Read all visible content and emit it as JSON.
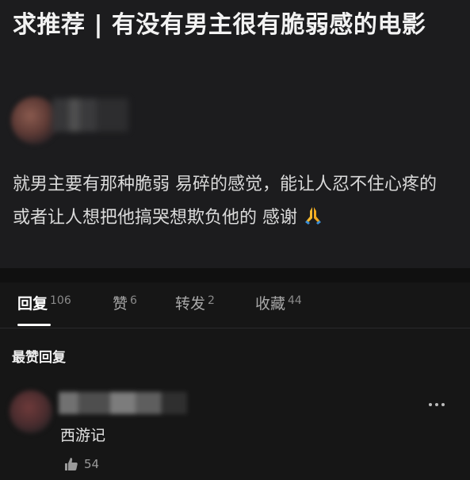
{
  "post": {
    "title": "求推荐 | 有没有男主很有脆弱感的电影",
    "body": "就男主要有那种脆弱 易碎的感觉，能让人忍不住心疼的 或者让人想把他搞哭想欺负他的 感谢",
    "emoji_icon": "folded-hands-icon"
  },
  "tabs": [
    {
      "label": "回复",
      "count": "106",
      "active": true
    },
    {
      "label": "赞",
      "count": "6",
      "active": false
    },
    {
      "label": "转发",
      "count": "2",
      "active": false
    },
    {
      "label": "收藏",
      "count": "44",
      "active": false
    }
  ],
  "section_label": "最赞回复",
  "comment": {
    "text": "西游记",
    "likes": "54",
    "like_icon": "thumbs-up-icon",
    "more_icon": "more-dots-icon"
  },
  "colors": {
    "background": "#161616",
    "post_background": "#1c1c1e",
    "active_tab": "#ffffff",
    "inactive_tab": "#a9a9a9",
    "emoji": "#f5b82e"
  }
}
